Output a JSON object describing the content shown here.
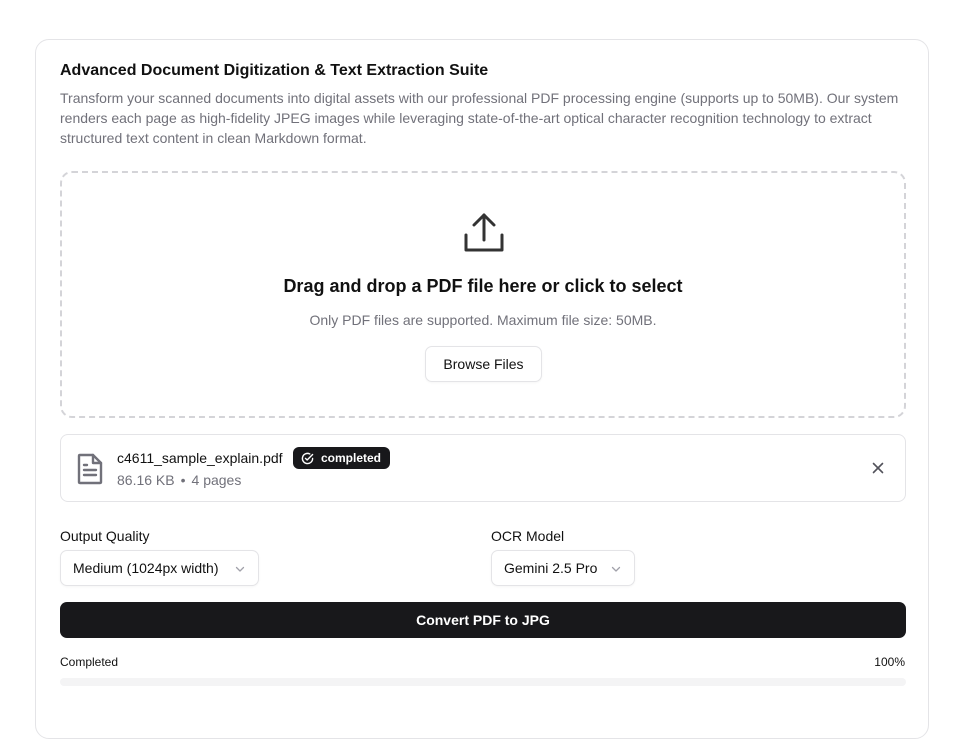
{
  "header": {
    "title": "Advanced Document Digitization & Text Extraction Suite",
    "description": "Transform your scanned documents into digital assets with our professional PDF processing engine (supports up to 50MB). Our system renders each page as high-fidelity JPEG images while leveraging state-of-the-art optical character recognition technology to extract structured text content in clean Markdown format."
  },
  "dropzone": {
    "icon": "upload-icon",
    "title": "Drag and drop a PDF file here or click to select",
    "hint": "Only PDF files are supported. Maximum file size: 50MB.",
    "browse_label": "Browse Files"
  },
  "file": {
    "icon": "file-text-icon",
    "name": "c4611_sample_explain.pdf",
    "status": "completed",
    "size": "86.16 KB",
    "separator": "•",
    "pages": "4 pages"
  },
  "settings": {
    "quality_label": "Output Quality",
    "quality_value": "Medium (1024px width)",
    "model_label": "OCR Model",
    "model_value": "Gemini 2.5 Pro"
  },
  "actions": {
    "convert_label": "Convert PDF to JPG"
  },
  "progress": {
    "label": "Completed",
    "value_text": "100%",
    "value": 100
  },
  "colors": {
    "primary": "#18181b",
    "muted_text": "#71717a",
    "border": "#e4e4e7"
  }
}
